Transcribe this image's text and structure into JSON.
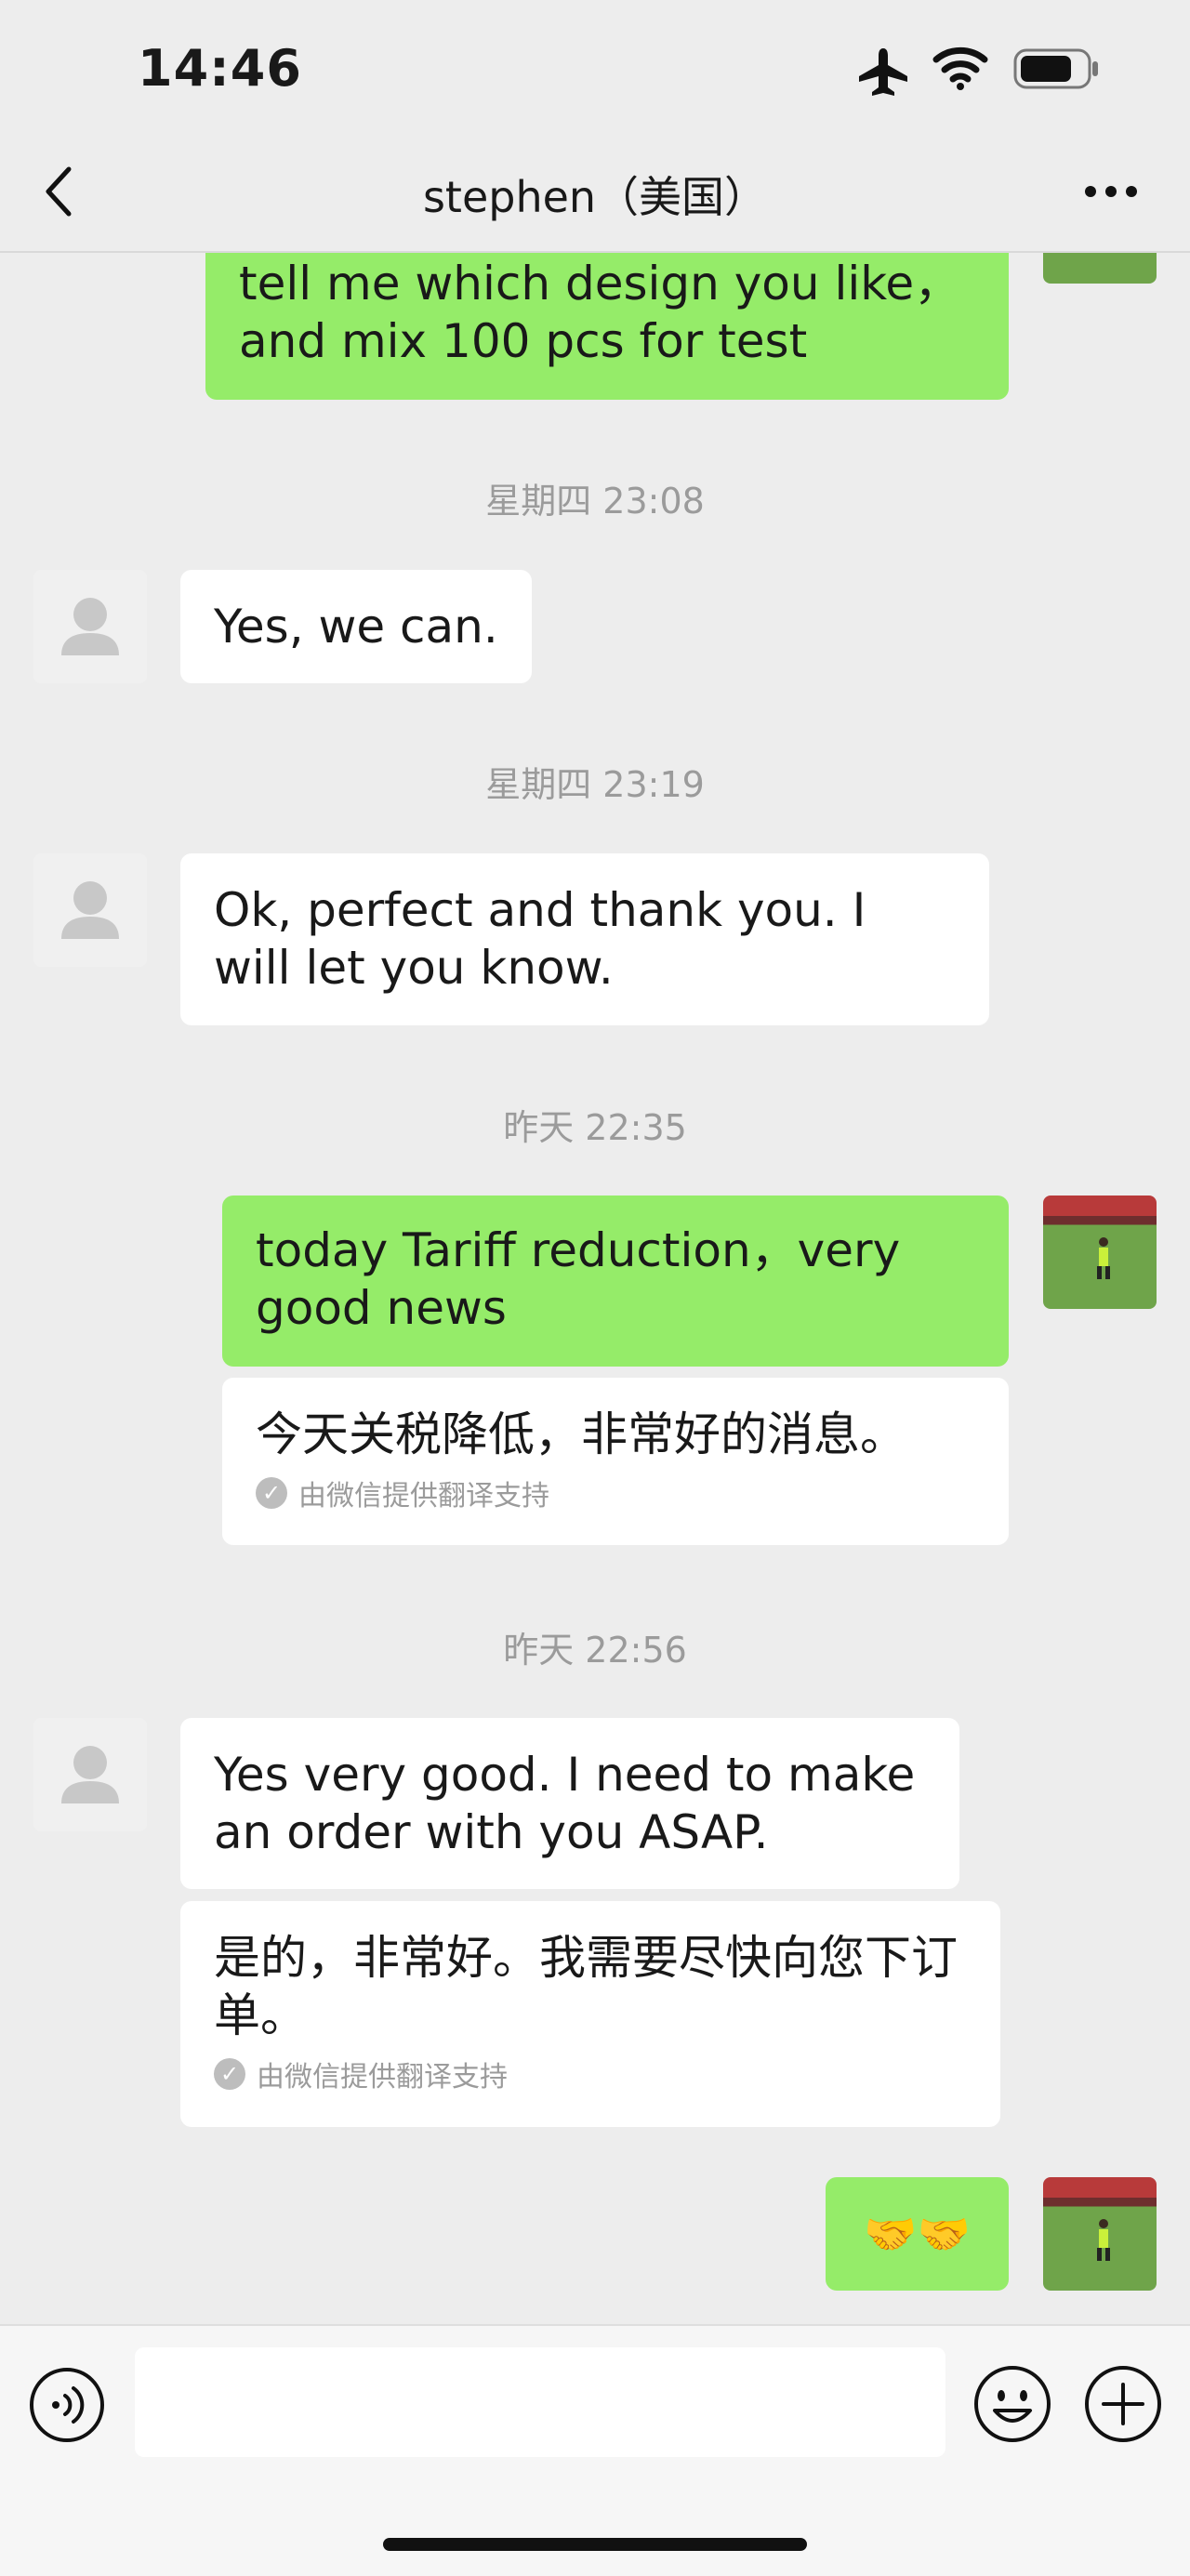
{
  "status_bar": {
    "time": "14:46"
  },
  "nav": {
    "title": "stephen（美国）"
  },
  "messages": {
    "m1": {
      "text": "tell me which design you like，and mix 100 pcs for test"
    },
    "ts1": "星期四 23:08",
    "m2": {
      "text": "Yes, we can."
    },
    "ts2": "星期四 23:19",
    "m3": {
      "text": "Ok, perfect and thank you. I will let you know."
    },
    "ts3": "昨天 22:35",
    "m4": {
      "text": "today Tariff reduction，very good news",
      "translation": "今天关税降低，非常好的消息。",
      "translation_credit": "由微信提供翻译支持"
    },
    "ts4": "昨天 22:56",
    "m5": {
      "text": "Yes very good. I need to make an order with you ASAP.",
      "translation": "是的，非常好。我需要尽快向您下订单。",
      "translation_credit": "由微信提供翻译支持"
    },
    "m6": {
      "text": "🤝🤝"
    }
  },
  "input_bar": {
    "value": "",
    "placeholder": ""
  },
  "icons": {
    "back": "chevron-left-icon",
    "more": "more-dots-icon",
    "voice": "voice-icon",
    "emoji": "emoji-icon",
    "plus": "plus-icon",
    "airplane": "airplane-icon",
    "wifi": "wifi-icon",
    "battery": "battery-icon"
  },
  "colors": {
    "outgoing_bubble": "#95ec69",
    "incoming_bubble": "#ffffff",
    "background": "#ededed"
  }
}
